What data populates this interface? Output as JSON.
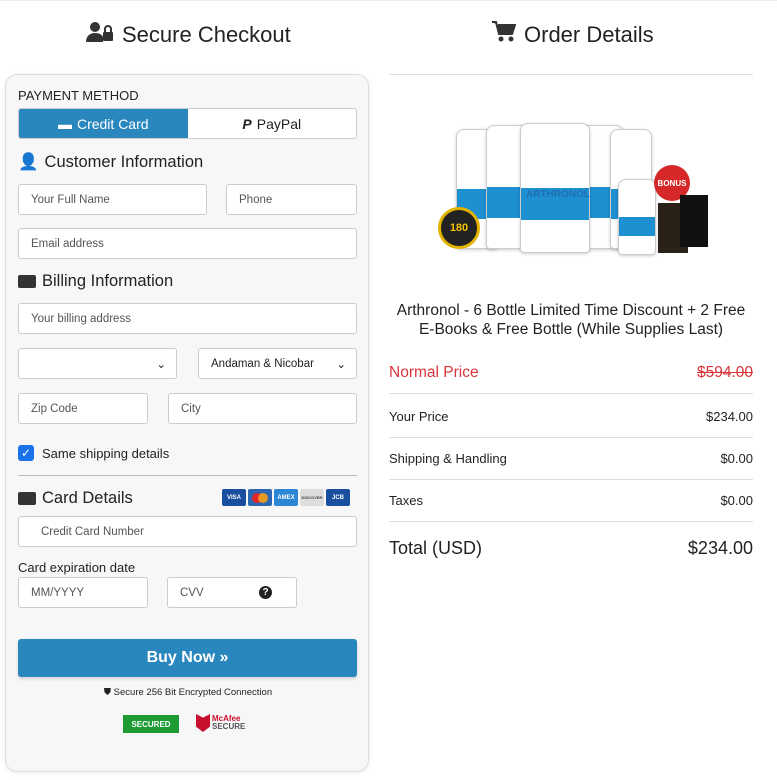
{
  "header": {
    "left_title": "Secure Checkout",
    "right_title": "Order Details"
  },
  "payment": {
    "label": "PAYMENT METHOD",
    "tabs": [
      {
        "label": "Credit Card",
        "active": true
      },
      {
        "label": "PayPal",
        "active": false
      }
    ]
  },
  "customer": {
    "title": "Customer Information",
    "full_name_placeholder": "Your Full Name",
    "phone_placeholder": "Phone",
    "email_placeholder": "Email address"
  },
  "billing": {
    "title": "Billing Information",
    "address_placeholder": "Your billing address",
    "country_value": "",
    "state_value": "Andaman & Nicobar",
    "zip_placeholder": "Zip Code",
    "city_placeholder": "City",
    "same_shipping_label": "Same shipping details",
    "same_shipping_checked": true
  },
  "card": {
    "title": "Card Details",
    "brands": [
      "VISA",
      "MC",
      "AMEX",
      "DISCOVER",
      "JCB"
    ],
    "number_placeholder": "Credit Card Number",
    "expiry_label": "Card expiration date",
    "expiry_placeholder": "MM/YYYY",
    "cvv_placeholder": "CVV"
  },
  "buy_button": "Buy Now »",
  "secure_text": "Secure 256 Bit Encrypted Connection",
  "badges": {
    "trustguard": "SECURED",
    "mcafee_1": "McAfee",
    "mcafee_2": "SECURE"
  },
  "product": {
    "name": "Arthronol - 6 Bottle Limited Time Discount + 2 Free E-Books & Free Bottle (While Supplies Last)",
    "bottle_label": "ARTHRONOL",
    "bonus": "BONUS",
    "guarantee": "180"
  },
  "order": {
    "normal_price_label": "Normal Price",
    "normal_price": "$594.00",
    "your_price_label": "Your Price",
    "your_price": "$234.00",
    "shipping_label": "Shipping & Handling",
    "shipping": "$0.00",
    "taxes_label": "Taxes",
    "taxes": "$0.00",
    "total_label": "Total (USD)",
    "total": "$234.00"
  },
  "colors": {
    "accent": "#2a87bd",
    "normal_price": "#d9343a"
  }
}
